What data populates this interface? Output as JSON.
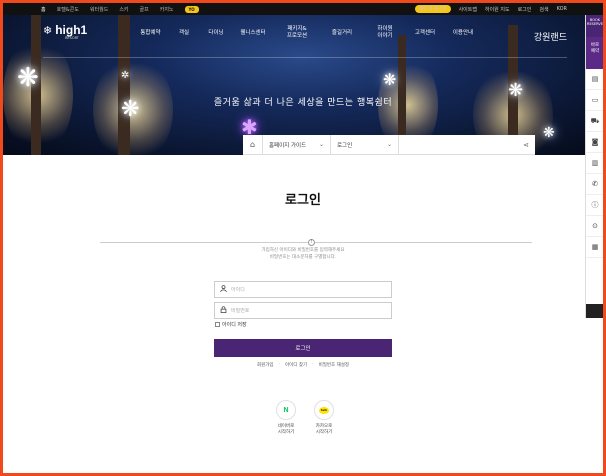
{
  "topbar": {
    "menu": [
      "홈",
      "호텔&콘도",
      "워터월드",
      "스키",
      "골프",
      "카지노"
    ],
    "yo_badge": "YO",
    "reserve_pill": "예약 후 즐기기",
    "right_links": [
      "사이트맵",
      "하이원 지도",
      "로그인",
      "검색",
      "KOR"
    ]
  },
  "logo": {
    "mark": "❄",
    "name": "high1",
    "sub": "RESORT"
  },
  "gnb": [
    "통합예약",
    "객실",
    "다이닝",
    "웰니스센터",
    "패키지&\n프로모션",
    "즐길거리",
    "하이원\n이야기",
    "고객센터",
    "이용안내"
  ],
  "brand_right": "강원랜드",
  "hero": {
    "slogan": "즐거움 삶과 더 나은 세상을 만드는 행복쉼터"
  },
  "breadcrumb": {
    "home_icon": "⌂",
    "section": "홈페이지 가이드",
    "page": "로그인",
    "chevron": "⌄",
    "share_icon": "⋖"
  },
  "quick_bar": {
    "book_label": "BOOK\nRESERVE",
    "reserve_label": "바로\n예약",
    "icons": [
      "calendar-icon",
      "bus-icon",
      "car-icon",
      "ticket-icon",
      "building-icon",
      "phone-icon",
      "info-icon",
      "location-icon",
      "grid-icon"
    ],
    "glyphs": [
      "▤",
      "▭",
      "⛟",
      "◙",
      "▥",
      "✆",
      "ⓘ",
      "⊙",
      "▦"
    ]
  },
  "login": {
    "title": "로그인",
    "divider_dot": "!",
    "notice_line1": "가입하신 아이디와 비밀번호를 입력해주세요",
    "notice_line2": "비밀번호는 대소문자를 구별합니다.",
    "id_placeholder": "아이디",
    "pw_placeholder": "비밀번호",
    "save_id": "아이디 저장",
    "login_button": "로그인",
    "links": [
      "회원가입",
      "아이디 찾기",
      "비밀번호 재설정"
    ],
    "link_sep": "·"
  },
  "social": {
    "naver_mark": "N",
    "naver_label_1": "네이버로",
    "naver_label_2": "시작하기",
    "kakao_mark": "talk",
    "kakao_label_1": "카카오로",
    "kakao_label_2": "시작하기"
  },
  "colors": {
    "accent": "#4a2574",
    "border_frame": "#f04a1c",
    "naver": "#03c75a",
    "kakao": "#fee500",
    "pill": "#f5c518"
  }
}
